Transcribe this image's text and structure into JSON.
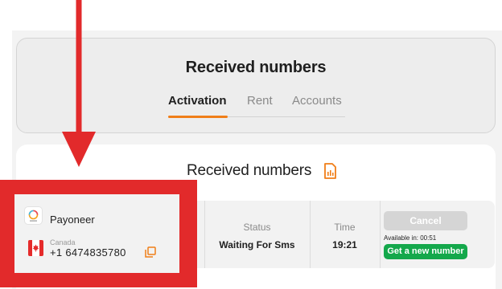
{
  "header": {
    "title": "Received numbers",
    "tabs": [
      {
        "label": "Activation",
        "active": true
      },
      {
        "label": "Rent",
        "active": false
      },
      {
        "label": "Accounts",
        "active": false
      }
    ]
  },
  "main": {
    "title": "Received numbers",
    "title_icon": "document-icon",
    "order": {
      "service": "Payoneer",
      "country": "Canada",
      "phone": "+1 6474835780",
      "status_label": "Status",
      "status_value": "Waiting For Sms",
      "time_label": "Time",
      "time_value": "19:21",
      "cancel_label": "Cancel",
      "available_label": "Available in:",
      "available_value": "00:51",
      "new_number_label": "Get a new number"
    }
  },
  "colors": {
    "accent": "#f07e18",
    "annotation": "#e22a2b",
    "success": "#14a84b"
  }
}
